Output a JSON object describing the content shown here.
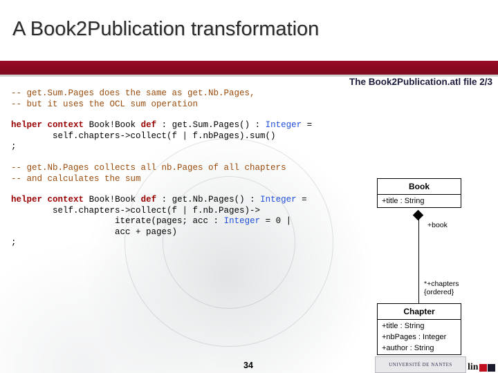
{
  "slide": {
    "title": "A Book2Publication transformation",
    "file_label": "The Book2Publication.atl file 2/3",
    "page_number": "34"
  },
  "code": {
    "block1": [
      "-- get.Sum.Pages does the same as get.Nb.Pages,",
      "-- but it uses the OCL sum operation"
    ],
    "block2": {
      "line1_kw1": "helper",
      "line1_kw2": "context",
      "line1_mid": "Book!Book ",
      "line1_kw3": "def",
      "line1_sig": " : get.Sum.Pages() : ",
      "line1_type": "Integer",
      "line1_end": " =",
      "line2": "        self.chapters->collect(f | f.nbPages).sum()",
      "line3": ";"
    },
    "block3": [
      "-- get.Nb.Pages collects all nb.Pages of all chapters",
      "-- and calculates the sum"
    ],
    "block4": {
      "line1_kw1": "helper",
      "line1_kw2": "context",
      "line1_mid": "Book!Book ",
      "line1_kw3": "def",
      "line1_sig": " : get.Nb.Pages() : ",
      "line1_type": "Integer",
      "line1_end": " =",
      "line2": "        self.chapters->collect(f | f.nb.Pages)->",
      "line3_pre": "                    iterate(pages; acc : ",
      "line3_type": "Integer",
      "line3_post": " = 0 |",
      "line4": "                    acc + pages)",
      "line5": ";"
    }
  },
  "diagram": {
    "book": {
      "name": "Book",
      "attributes": [
        "+title : String"
      ]
    },
    "chapter": {
      "name": "Chapter",
      "attributes": [
        "+title : String",
        "+nbPages : Integer",
        "+author : String"
      ]
    },
    "role_book": "+book",
    "role_chapters": "*+chapters",
    "role_chapters_note": "{ordered}"
  },
  "footer": {
    "university_logo_text": "UNIVERSITÉ DE NANTES",
    "brand_text": "lin"
  }
}
